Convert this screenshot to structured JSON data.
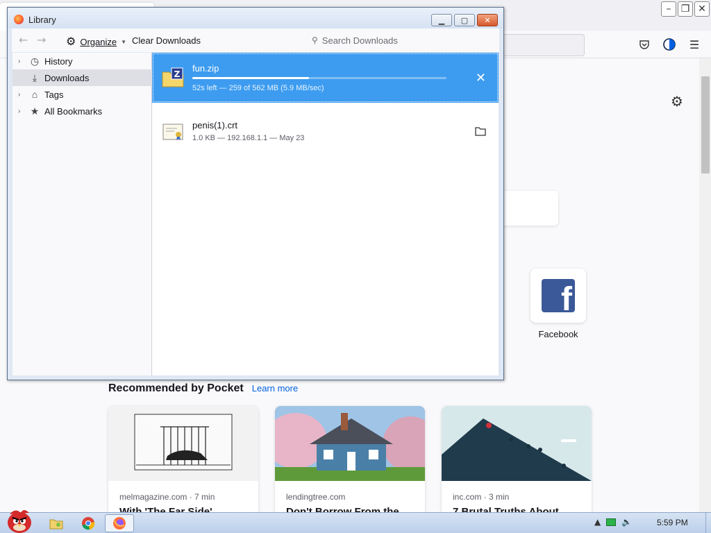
{
  "browser": {
    "settings_icon": "gear-icon",
    "toolbar_icons": [
      "pocket-icon",
      "profile-icon",
      "menu-icon"
    ],
    "shortcut": {
      "label": "Facebook",
      "icon": "facebook-icon"
    },
    "pocket": {
      "title": "Recommended by Pocket",
      "learn_more": "Learn more",
      "cards": [
        {
          "source": "melmagazine.com · 7 min",
          "title": "With 'The Far Side'"
        },
        {
          "source": "lendingtree.com",
          "title": "Don't Borrow From the"
        },
        {
          "source": "inc.com · 3 min",
          "title": "7 Brutal Truths About"
        }
      ]
    }
  },
  "library": {
    "title": "Library",
    "toolbar": {
      "organize": "Organize",
      "clear": "Clear Downloads",
      "search_placeholder": "Search Downloads"
    },
    "sidebar": [
      {
        "label": "History",
        "icon": "clock-icon",
        "expandable": true
      },
      {
        "label": "Downloads",
        "icon": "download-icon",
        "expandable": false,
        "selected": true
      },
      {
        "label": "Tags",
        "icon": "tag-icon",
        "expandable": true
      },
      {
        "label": "All Bookmarks",
        "icon": "star-icon",
        "expandable": true
      }
    ],
    "downloads": [
      {
        "name": "fun.zip",
        "status": "52s left — 259 of 562 MB (5.9 MB/sec)",
        "progress": 0.46,
        "icon": "zip-file-icon",
        "action": "cancel-icon"
      },
      {
        "name": "penis(1).crt",
        "status": "1.0 KB — 192.168.1.1 — May 23",
        "icon": "certificate-file-icon",
        "action": "folder-icon"
      }
    ]
  },
  "taskbar": {
    "clock": "5:59 PM",
    "apps": [
      "folder-app-icon",
      "chrome-app-icon",
      "firefox-app-icon"
    ]
  },
  "colors": {
    "selection": "#3d9cf0",
    "link": "#0060df",
    "facebook": "#3b5998"
  }
}
